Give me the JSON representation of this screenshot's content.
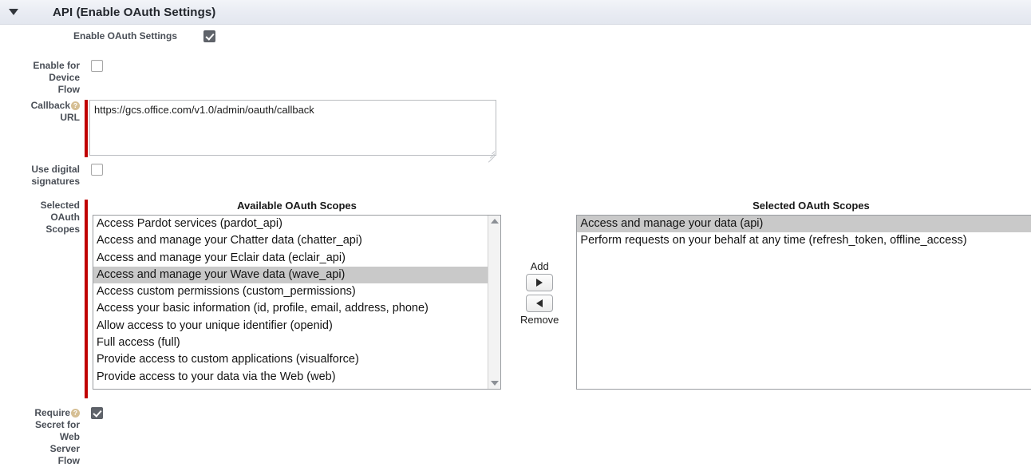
{
  "section": {
    "title": "API (Enable OAuth Settings)",
    "disclosure_icon": "triangle-down-icon",
    "expanded": true
  },
  "fields": {
    "enable_oauth": {
      "label": "Enable OAuth Settings",
      "checked": true,
      "required": false
    },
    "enable_device_flow": {
      "label": "Enable for Device Flow",
      "checked": false,
      "required": false
    },
    "callback_url": {
      "label": "Callback URL",
      "help_icon": "help-question-icon",
      "help_glyph": "?",
      "value": "https://gcs.office.com/v1.0/admin/oauth/callback",
      "required": true
    },
    "use_digital_signatures": {
      "label": "Use digital signatures",
      "checked": false,
      "required": false
    },
    "selected_oauth_scopes": {
      "label": "Selected OAuth Scopes",
      "required": true
    },
    "require_secret_web_server": {
      "label": "Require Secret for Web Server Flow",
      "help_icon": "help-question-icon",
      "help_glyph": "?",
      "checked": true,
      "required": false
    }
  },
  "dual_list": {
    "available": {
      "header": "Available OAuth Scopes",
      "options": [
        {
          "label": "Access Pardot services (pardot_api)",
          "selected": false
        },
        {
          "label": "Access and manage your Chatter data (chatter_api)",
          "selected": false
        },
        {
          "label": "Access and manage your Eclair data (eclair_api)",
          "selected": false
        },
        {
          "label": "Access and manage your Wave data (wave_api)",
          "selected": true
        },
        {
          "label": "Access custom permissions (custom_permissions)",
          "selected": false
        },
        {
          "label": "Access your basic information (id, profile, email, address, phone)",
          "selected": false
        },
        {
          "label": "Allow access to your unique identifier (openid)",
          "selected": false
        },
        {
          "label": "Full access (full)",
          "selected": false
        },
        {
          "label": "Provide access to custom applications (visualforce)",
          "selected": false
        },
        {
          "label": "Provide access to your data via the Web (web)",
          "selected": false
        }
      ]
    },
    "selected": {
      "header": "Selected OAuth Scopes",
      "options": [
        {
          "label": "Access and manage your data (api)",
          "selected": true
        },
        {
          "label": "Perform requests on your behalf at any time (refresh_token, offline_access)",
          "selected": false
        }
      ]
    },
    "add_button": {
      "label": "Add",
      "icon": "triangle-right-icon"
    },
    "remove_button": {
      "label": "Remove",
      "icon": "triangle-left-icon"
    },
    "scroll_up_icon": "scroll-up-arrow-icon",
    "scroll_down_icon": "scroll-down-arrow-icon"
  },
  "colors": {
    "required_bar": "#c00000",
    "header_bg": "#e9ecf3",
    "selected_row": "#c9c9c9",
    "checkbox_checked": "#60646b",
    "help_icon": "#d6bf94"
  }
}
